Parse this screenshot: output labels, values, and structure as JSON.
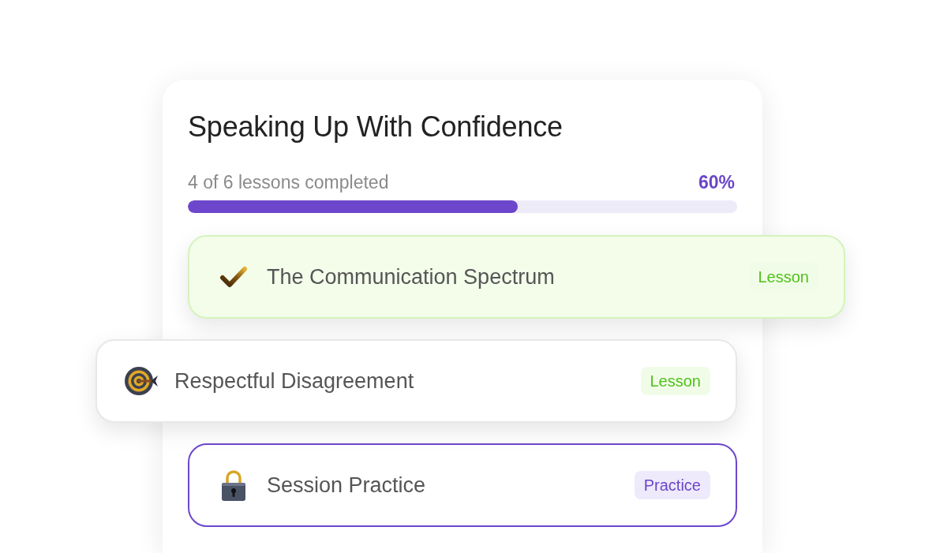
{
  "course": {
    "title": "Speaking Up With Confidence",
    "progress": {
      "label": "4 of 6 lessons completed",
      "reading": "60%",
      "level": 0.6
    }
  },
  "lessons": [
    {
      "title": "The Communication Spectrum",
      "kind": "completed",
      "selected": false,
      "tag": {
        "label": "Lesson",
        "kind": "lesson"
      }
    },
    {
      "title": "Respectful Disagreement",
      "kind": "current",
      "selected": false,
      "tag": {
        "label": "Lesson",
        "kind": "lesson"
      }
    },
    {
      "title": "Session Practice",
      "kind": "locked",
      "selected": true,
      "tag": {
        "label": "Practice",
        "kind": "practice"
      }
    }
  ]
}
